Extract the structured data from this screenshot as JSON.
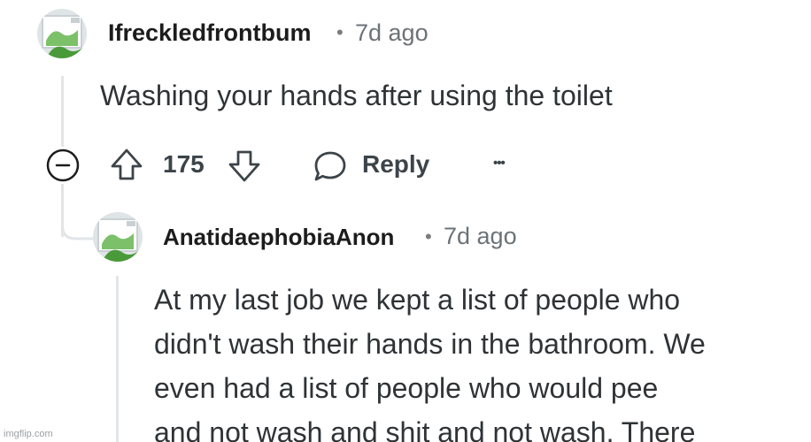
{
  "comment1": {
    "username": "Ifreckledfrontbum",
    "separator": "•",
    "time": "7d ago",
    "body": "Washing your hands after using the toilet",
    "score": "175",
    "reply_label": "Reply",
    "more_label": "•••",
    "collapse_symbol": "−"
  },
  "comment2": {
    "username": "AnatidaephobiaAnon",
    "separator": "•",
    "time": "7d ago",
    "lines": [
      "At my last job we kept a list of people who",
      "didn't wash their hands in the bathroom. We",
      "even had a list of people who would pee",
      "and not wash and shit and not wash. There"
    ]
  },
  "colors": {
    "thread_line": "#e2e5e8",
    "text_primary": "#1c1c1c",
    "text_secondary": "#6b7378",
    "avatar_bg": "#dfe4e7",
    "avatar_green": "#4a9a3a"
  },
  "watermark": "imgflip.com"
}
